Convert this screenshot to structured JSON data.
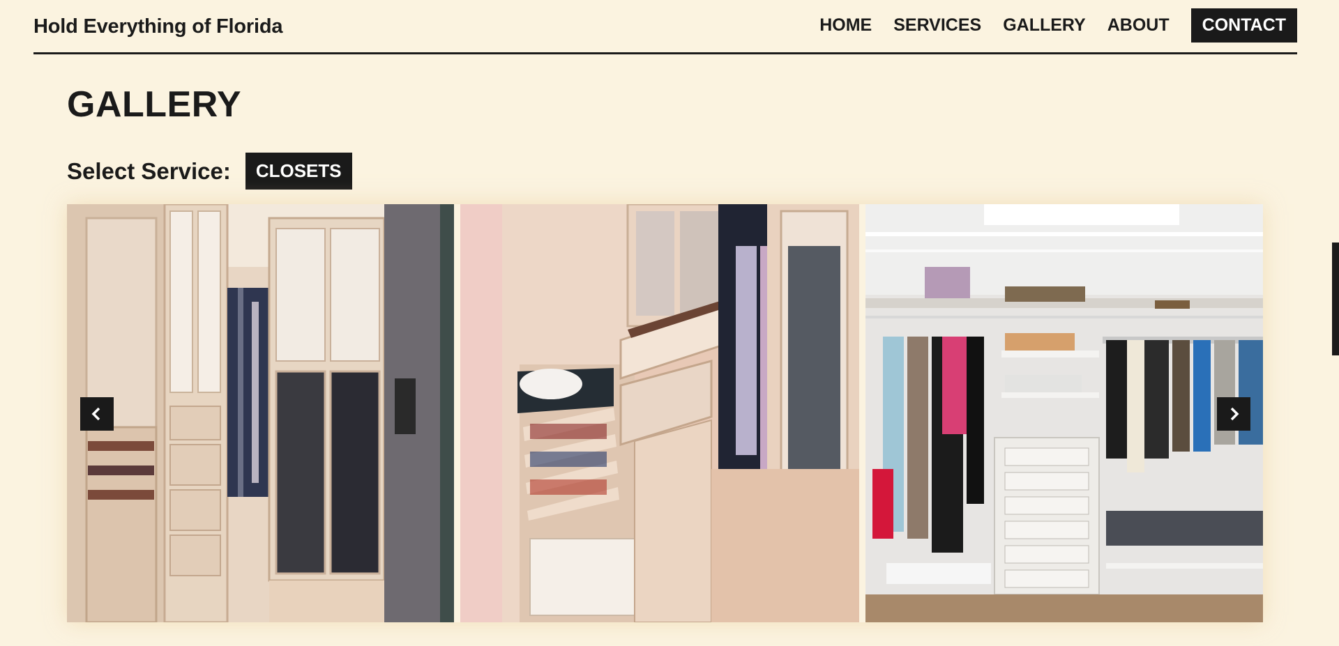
{
  "header": {
    "brand": "Hold Everything of Florida",
    "nav": [
      "HOME",
      "SERVICES",
      "GALLERY",
      "ABOUT"
    ],
    "contact": "CONTACT"
  },
  "page": {
    "title": "GALLERY",
    "select_label": "Select Service:",
    "selected_service": "CLOSETS"
  },
  "carousel": {
    "slides": [
      "closet-photo-1",
      "closet-photo-2",
      "closet-photo-3"
    ],
    "prev_icon": "chevron-left-icon",
    "next_icon": "chevron-right-icon"
  },
  "colors": {
    "background": "#fbf3e0",
    "ink": "#1a1a1a"
  }
}
